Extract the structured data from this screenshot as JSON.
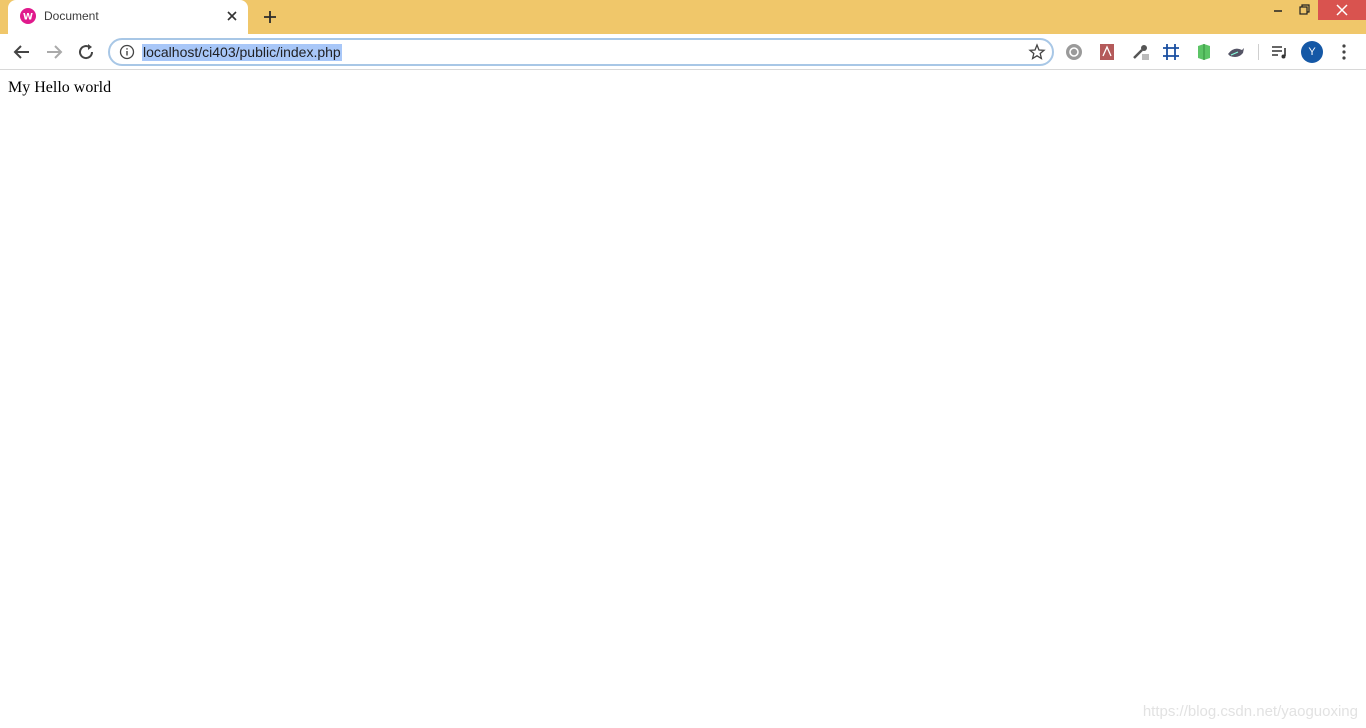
{
  "tab": {
    "title": "Document"
  },
  "toolbar": {
    "url": "localhost/ci403/public/index.php",
    "avatar_letter": "Y"
  },
  "page": {
    "text": "My Hello world"
  },
  "watermark": "https://blog.csdn.net/yaoguoxing",
  "icons": {
    "favicon": "wamp-icon",
    "extensions": [
      "history-icon",
      "pdf-icon",
      "eyedropper-icon",
      "frame-icon",
      "green-extension-icon",
      "bird-extension-icon",
      "playlist-icon"
    ]
  },
  "colors": {
    "tabstrip": "#f0c76a",
    "url_highlight": "#a8c7f8",
    "window_close": "#d9534f",
    "avatar": "#1558a6"
  }
}
